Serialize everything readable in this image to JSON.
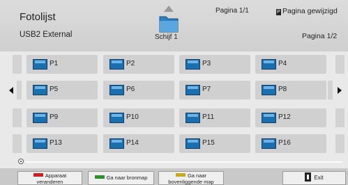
{
  "header": {
    "title": "Fotolijst",
    "device": "USB2 External",
    "page_top": "Pagina 1/1",
    "page_change_badge": "P",
    "page_change": "Pagina gewijzigd",
    "page_right": "Pagina 1/2",
    "disk_label": "Schijf 1",
    "disk_icon": "folder-disk-icon"
  },
  "folders": [
    [
      {
        "label": "P1"
      },
      {
        "label": "P2"
      },
      {
        "label": "P3"
      },
      {
        "label": "P4"
      }
    ],
    [
      {
        "label": "P5"
      },
      {
        "label": "P6"
      },
      {
        "label": "P7"
      },
      {
        "label": "P8"
      }
    ],
    [
      {
        "label": "P9"
      },
      {
        "label": "P10"
      },
      {
        "label": "P11"
      },
      {
        "label": "P12"
      }
    ],
    [
      {
        "label": "P13"
      },
      {
        "label": "P14"
      },
      {
        "label": "P15"
      },
      {
        "label": "P16"
      }
    ]
  ],
  "footer": {
    "btn_device_line1": "Apparaat",
    "btn_device_line2": "veranderen",
    "btn_source": "Ga naar bronmap",
    "btn_parent_line1": "Ga naar",
    "btn_parent_line2": "bovenliggende map",
    "btn_exit": "Exit"
  },
  "colors": {
    "folder": "#1a6fae",
    "background": "#e9e9e9",
    "cell": "#d0d0d0"
  }
}
